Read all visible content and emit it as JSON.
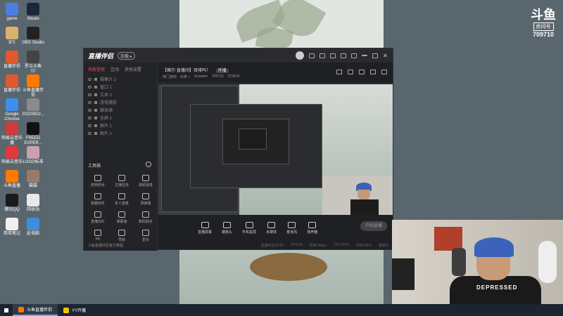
{
  "desktop_icons": [
    {
      "label": "game",
      "color": "#4a7ee0"
    },
    {
      "label": "Steam",
      "color": "#1b2838"
    },
    {
      "label": "BTI",
      "color": "#d9b26b"
    },
    {
      "label": "OBS Studio",
      "color": "#222222"
    },
    {
      "label": "直播伴侣",
      "color": "#e25a2b"
    },
    {
      "label": "罗兰斗鱼（I）",
      "color": "#444444"
    },
    {
      "label": "直播伴侣",
      "color": "#e25a2b"
    },
    {
      "label": "斗鱼直播伴侣",
      "color": "#ff7a00"
    },
    {
      "label": "Google Chrome",
      "color": "#3d8ef1"
    },
    {
      "label": "20220622...",
      "color": "#8a8a8a"
    },
    {
      "label": "网易云音乐 播",
      "color": "#d23b3b"
    },
    {
      "label": "FREED EXPER...",
      "color": "#111111"
    },
    {
      "label": "网易云音乐",
      "color": "#e0383b"
    },
    {
      "label": "LOGO标准",
      "color": "#c8a0b0"
    },
    {
      "label": "斗鱼直播",
      "color": "#ff7a00"
    },
    {
      "label": "猫猫",
      "color": "#9a7a6a"
    },
    {
      "label": "腾讯QQ",
      "color": "#1a1a1a"
    },
    {
      "label": "回收站",
      "color": "#e8e8e8"
    },
    {
      "label": "简单笔记",
      "color": "#f0f0f0"
    },
    {
      "label": "此电脑",
      "color": "#3b8fd9"
    }
  ],
  "brand": {
    "logo": "斗鱼",
    "room_label": "房间号",
    "room_number": "709710"
  },
  "app": {
    "title": "直播伴侣",
    "version": "加载 ▸",
    "left_tabs": [
      "场景管理",
      "互动",
      "其他设置"
    ],
    "scenes": [
      "摄像头 2",
      "窗口 1",
      "文本 1",
      "游戏捕获",
      "媒体源",
      "全屏 1",
      "图片 1",
      "图片 2"
    ],
    "tools_title": "工具箱",
    "tools": [
      "房管助手",
      "主播任务",
      "视频连麦",
      "弹幕助手",
      "多人连麦",
      "录弹幕",
      "直播切片",
      "弹幕墙",
      "数码助手",
      "PK",
      "导航",
      "更多"
    ],
    "bottom_note": "斗鱼直播伴侣官方教程",
    "room_title": "【赌尔·直播间】双排吗！",
    "room_tag": "开播",
    "status": [
      "热门游戏 · 大神 ✓",
      "Invasion",
      "709710",
      "373610"
    ],
    "controls": [
      "直播屏幕",
      "摄像头",
      "手机投屏",
      "多媒体",
      "麦克风",
      "扬声器"
    ],
    "start_button": "开始直播",
    "status_line": [
      "直播时长00:00",
      "FPS:60",
      "码率:0kbps",
      "CPU:34%",
      "内存:56%",
      "丢帧:0"
    ]
  },
  "webcam": {
    "shirt_text": "DEPRESSED"
  },
  "taskbar": {
    "items": [
      {
        "label": "斗鱼直播伴侣",
        "color": "#ff7a00"
      },
      {
        "label": "YY开播",
        "color": "#f5c400"
      }
    ]
  }
}
